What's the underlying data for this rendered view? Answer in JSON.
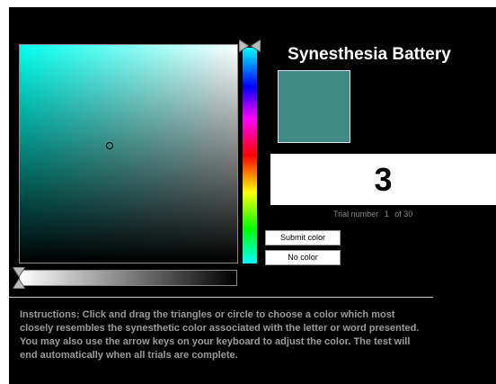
{
  "app": {
    "title": "Synesthesia Battery"
  },
  "color_picker": {
    "selected_color": "#3f8a84",
    "hue_base": "#00ffee"
  },
  "stimulus": {
    "value": "3"
  },
  "trial": {
    "label": "Trial number",
    "current": "1",
    "total_label": "of 30"
  },
  "buttons": {
    "submit_label": "Submit color",
    "no_color_label": "No color"
  },
  "instructions": {
    "text": "Instructions: Click and drag the triangles or circle to choose a color which most closely resembles the synesthetic color associated with the letter or word presented. You may also use the arrow keys on your keyboard to adjust the color. The test will end automatically when all trials are complete."
  },
  "icons": [
    "hue-slider-handle-icon",
    "brightness-slider-handle-icon",
    "color-cursor-icon"
  ]
}
